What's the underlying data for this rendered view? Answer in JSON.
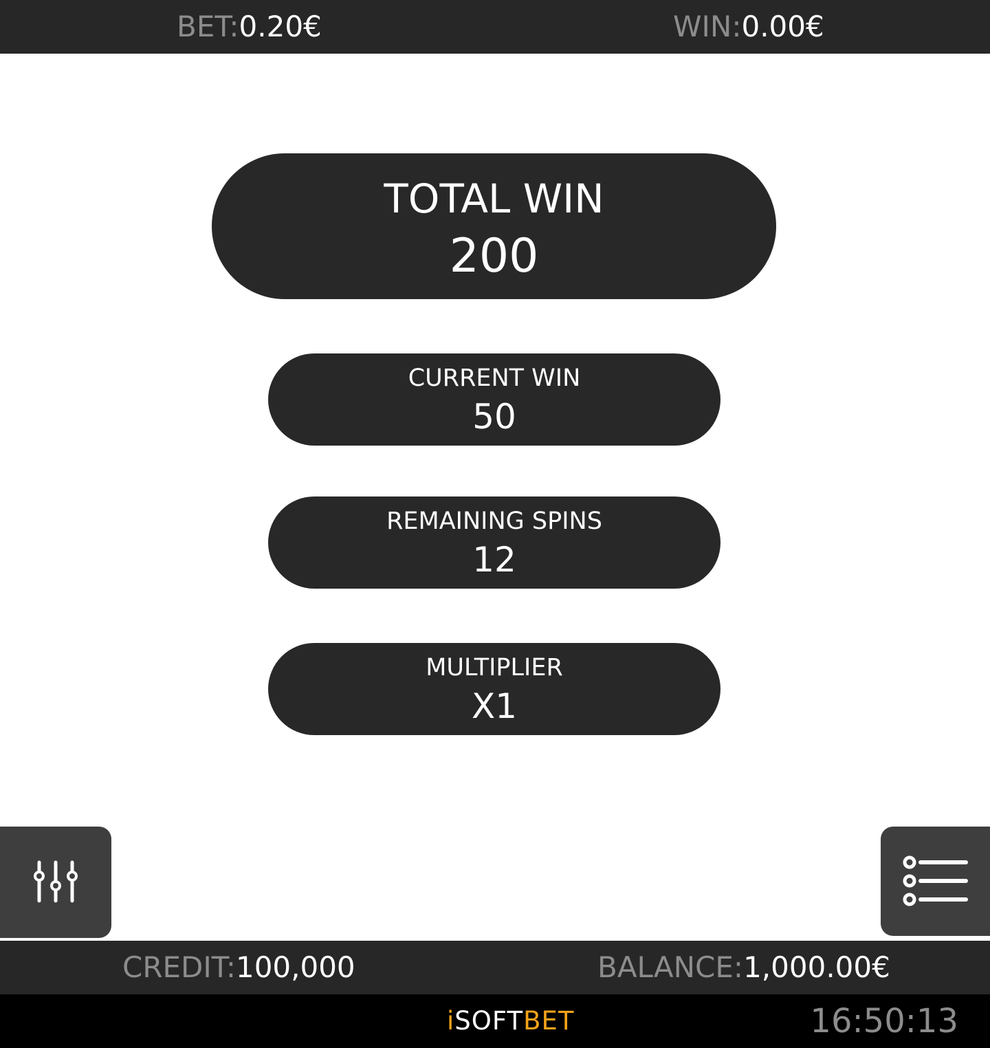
{
  "top_bar": {
    "bet_label": "BET:",
    "bet_value": "0.20€",
    "win_label": "WIN:",
    "win_value": "0.00€"
  },
  "total_win": {
    "label": "TOTAL WIN",
    "value": "200"
  },
  "current_win": {
    "label": "CURRENT WIN",
    "value": "50"
  },
  "remaining_spins": {
    "label": "REMAINING SPINS",
    "value": "12"
  },
  "multiplier": {
    "label": "MULTIPLIER",
    "value": "X1"
  },
  "buttons": {
    "settings_icon": "sliders-icon",
    "menu_icon": "list-menu-icon"
  },
  "info_bar": {
    "credit_label": "CREDIT:",
    "credit_value": "100,000",
    "balance_label": "BALANCE:",
    "balance_value": "1,000.00€"
  },
  "footer": {
    "logo_prefix": "i",
    "logo_middle": "SOFT",
    "logo_suffix": "BET",
    "clock": "16:50:13"
  },
  "colors": {
    "bar_background": "#272727",
    "pill_background": "#282828",
    "button_background": "#3e3e3e",
    "label_grey": "#8c8c8c",
    "brand_orange": "#f5a21a"
  }
}
